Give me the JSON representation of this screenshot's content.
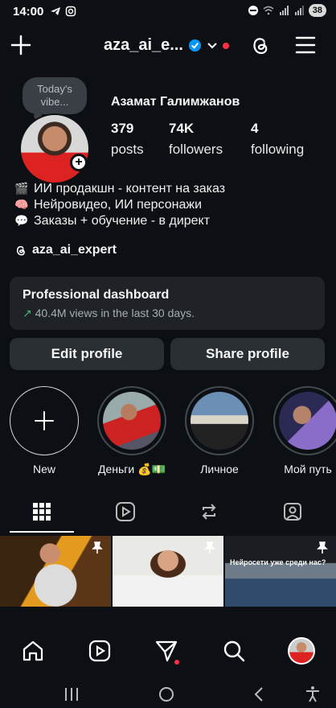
{
  "status_bar": {
    "time": "14:00",
    "battery": "38",
    "left_icons": [
      "telegram-icon",
      "instagram-icon"
    ],
    "right_icons": [
      "dnd-icon",
      "wifi-icon",
      "signal-icon",
      "signal-icon"
    ]
  },
  "header": {
    "username": "aza_ai_e...",
    "icons": [
      "plus-icon",
      "verified-icon",
      "chevron-down-icon",
      "threads-icon",
      "menu-icon"
    ]
  },
  "profile": {
    "note": "Today's vibe...",
    "full_name": "Азамат Галимжанов",
    "stats": [
      {
        "value": "379",
        "label": "posts"
      },
      {
        "value": "74K",
        "label": "followers"
      },
      {
        "value": "4",
        "label": "following"
      }
    ],
    "bio": [
      {
        "emoji": "🎬",
        "text": "ИИ продакшн - контент на заказ"
      },
      {
        "emoji": "🧠",
        "text": "Нейровидео, ИИ персонажи"
      },
      {
        "emoji": "💬",
        "text": "Заказы + обучение - в директ"
      }
    ],
    "threads_handle": "aza_ai_expert"
  },
  "dashboard": {
    "title": "Professional dashboard",
    "subtitle": "40.4M views in the last 30 days."
  },
  "buttons": {
    "edit": "Edit profile",
    "share": "Share profile"
  },
  "highlights": [
    {
      "label": "New"
    },
    {
      "label": "Деньги 💰💵"
    },
    {
      "label": "Личное"
    },
    {
      "label": "Мой путь"
    }
  ],
  "tabs": [
    "grid-icon",
    "reels-icon",
    "reposts-icon",
    "tagged-icon"
  ],
  "grid": {
    "post3_caption": "Нейросети уже среди нас?"
  },
  "bottom_nav": [
    "home-icon",
    "reels-icon",
    "direct-icon",
    "search-icon",
    "profile-icon"
  ],
  "colors": {
    "background": "#0c1014",
    "card": "#1f2328",
    "button": "#2a2f34",
    "accent_blue": "#0095f6",
    "notification_red": "#ff3040",
    "growth_green": "#3fb86b"
  }
}
